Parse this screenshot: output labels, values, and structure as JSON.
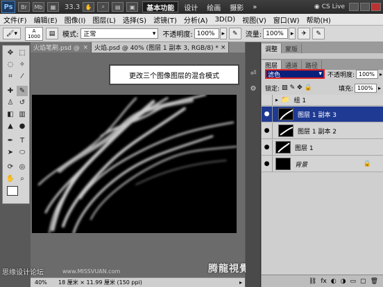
{
  "titlebar": {
    "logo": "Ps",
    "icons": [
      "Br",
      "Mb"
    ],
    "zoom": "33.3",
    "workspaces": [
      "基本功能",
      "设计",
      "绘画",
      "摄影"
    ],
    "more": "»",
    "cs_live": "CS Live"
  },
  "menu": [
    "文件(F)",
    "编辑(E)",
    "图像(I)",
    "图层(L)",
    "选择(S)",
    "滤镜(T)",
    "分析(A)",
    "3D(D)",
    "视图(V)",
    "窗口(W)",
    "帮助(H)"
  ],
  "options": {
    "brush_size": "1000",
    "mode_label": "模式:",
    "mode_value": "正常",
    "opacity_label": "不透明度:",
    "opacity_value": "100%",
    "flow_label": "流量:",
    "flow_value": "100%"
  },
  "doc_tabs": [
    {
      "label": "火焰笔刷.psd @ 10...",
      "active": false
    },
    {
      "label": "火焰.psd @ 40% (图层 1 副本 3, RGB/8) *",
      "active": true
    }
  ],
  "callout": "更改三个图像图层的混合模式",
  "status": {
    "zoom": "40%",
    "doc_size": "18 厘米 × 11.99 厘米 (150 ppi)"
  },
  "layers_panel": {
    "tabs": [
      "调整",
      "蒙版",
      "图层",
      "通道",
      "路径"
    ],
    "blend_mode": "滤色",
    "opacity_label": "不透明度:",
    "opacity_value": "100%",
    "lock_label": "锁定:",
    "fill_label": "填充:",
    "fill_value": "100%",
    "layers": [
      {
        "name": "组 1",
        "type": "group",
        "selected": false
      },
      {
        "name": "图层 1 副本 3",
        "type": "layer",
        "selected": true
      },
      {
        "name": "图层 1 副本 2",
        "type": "layer",
        "selected": false
      },
      {
        "name": "图层 1",
        "type": "layer",
        "selected": false
      },
      {
        "name": "背景",
        "type": "background",
        "selected": false
      }
    ]
  },
  "watermarks": {
    "left": "思缘设计论坛",
    "left_url": "www.MISSVUAN.com",
    "right": "腾龍視覺 WWW.TLVI.NET"
  },
  "colors": {
    "highlight": "#e02020",
    "selection": "#1f3a93"
  }
}
